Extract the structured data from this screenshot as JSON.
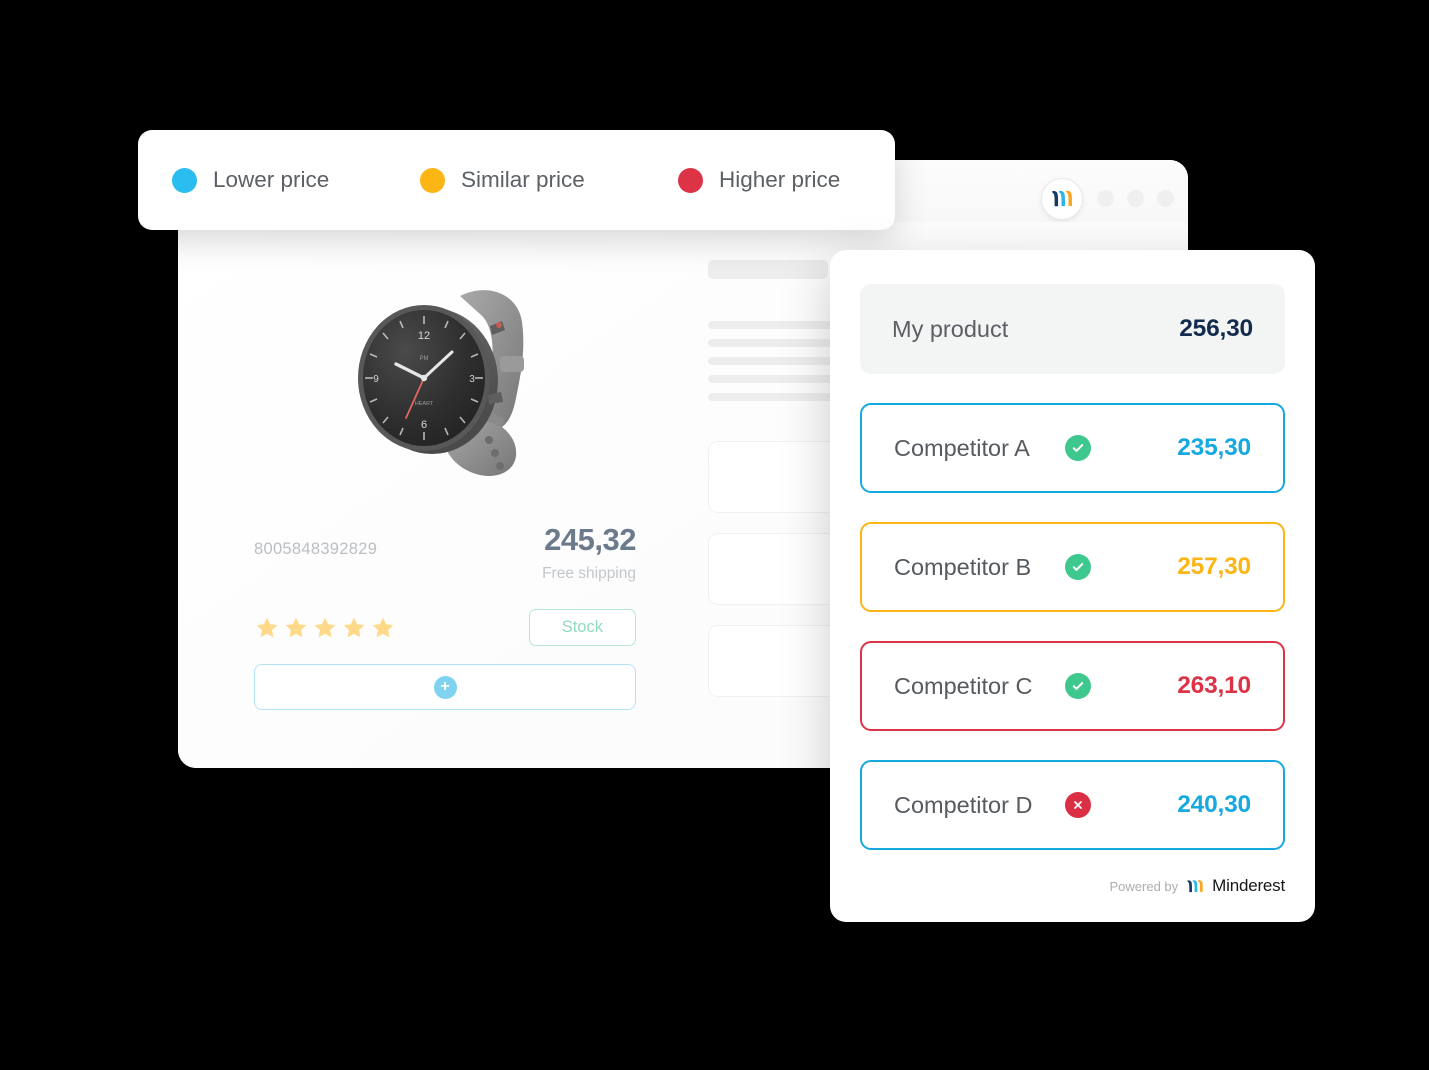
{
  "legend": {
    "items": [
      {
        "label": "Lower price",
        "color": "#29bdf0",
        "icon": "legend-dot-icon"
      },
      {
        "label": "Similar price",
        "color": "#fbb515",
        "icon": "legend-dot-icon"
      },
      {
        "label": "Higher price",
        "color": "#dc3347",
        "icon": "legend-dot-icon"
      }
    ]
  },
  "browser": {
    "logo_alt": "minderest-logo-icon",
    "url_placeholder": ""
  },
  "product": {
    "image_alt": "smartwatch-product-image",
    "ean": "8005848392829",
    "price": "245,32",
    "shipping": "Free shipping",
    "rating": 5,
    "stock_label": "Stock",
    "add_label": "+"
  },
  "comparison": {
    "my_product": {
      "name": "My product",
      "price": "256,30",
      "price_color": "#132b4d"
    },
    "competitors": [
      {
        "name": "Competitor A",
        "price": "235,30",
        "status": "ok",
        "border": "#16a9e0",
        "price_color": "#16a9e0"
      },
      {
        "name": "Competitor B",
        "price": "257,30",
        "status": "ok",
        "border": "#fbb515",
        "price_color": "#fbb515"
      },
      {
        "name": "Competitor C",
        "price": "263,10",
        "status": "ok",
        "border": "#dc3347",
        "price_color": "#dc3347"
      },
      {
        "name": "Competitor D",
        "price": "240,30",
        "status": "no",
        "border": "#16a9e0",
        "price_color": "#16a9e0"
      }
    ],
    "footer": {
      "powered_by": "Powered by",
      "brand": "Minderest"
    }
  },
  "skeleton": {
    "line_widths": [
      "100%",
      "100%",
      "100%",
      "96%",
      "100%"
    ],
    "cards": 3
  }
}
